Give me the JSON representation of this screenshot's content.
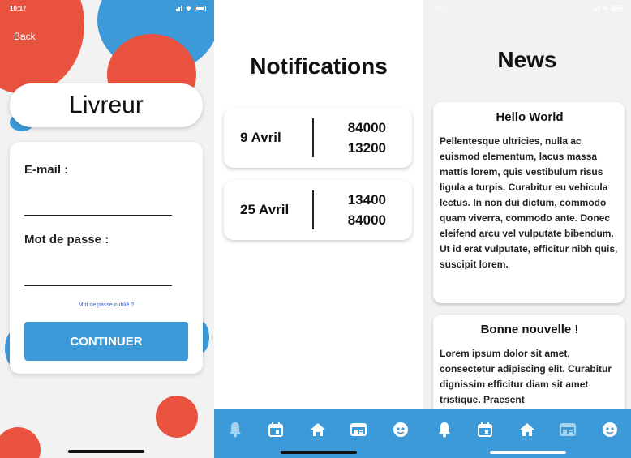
{
  "screen_login": {
    "status_time": "10:17",
    "back_label": "Back",
    "title": "Livreur",
    "email_label": "E-mail :",
    "password_label": "Mot de passe :",
    "forgot_label": "Mot de passe oublié ?",
    "continue_label": "CONTINUER"
  },
  "screen_notifications": {
    "title": "Notifications",
    "items": [
      {
        "date": "9 Avril",
        "code1": "84000",
        "code2": "13200"
      },
      {
        "date": "25 Avril",
        "code1": "13400",
        "code2": "84000"
      }
    ],
    "tabs": [
      "bell-icon",
      "calendar-icon",
      "home-icon",
      "newspaper-icon",
      "profile-icon"
    ]
  },
  "screen_news": {
    "status_time": "10:17",
    "title": "News",
    "articles": [
      {
        "title": "Hello World",
        "body": "Pellentesque ultricies, nulla ac euismod elementum, lacus massa mattis lorem, quis vestibulum risus ligula a turpis. Curabitur eu vehicula lectus. In non dui dictum, commodo quam viverra, commodo ante. Donec eleifend arcu vel vulputate bibendum. Ut id erat vulputate, efficitur nibh quis, suscipit lorem."
      },
      {
        "title": "Bonne nouvelle !",
        "body": "Lorem ipsum dolor sit amet, consectetur adipiscing elit. Curabitur dignissim efficitur diam sit amet tristique. Praesent"
      }
    ]
  },
  "colors": {
    "accent_blue": "#3d9ad8",
    "accent_red": "#e8523f",
    "link_blue": "#2b5fd9"
  }
}
